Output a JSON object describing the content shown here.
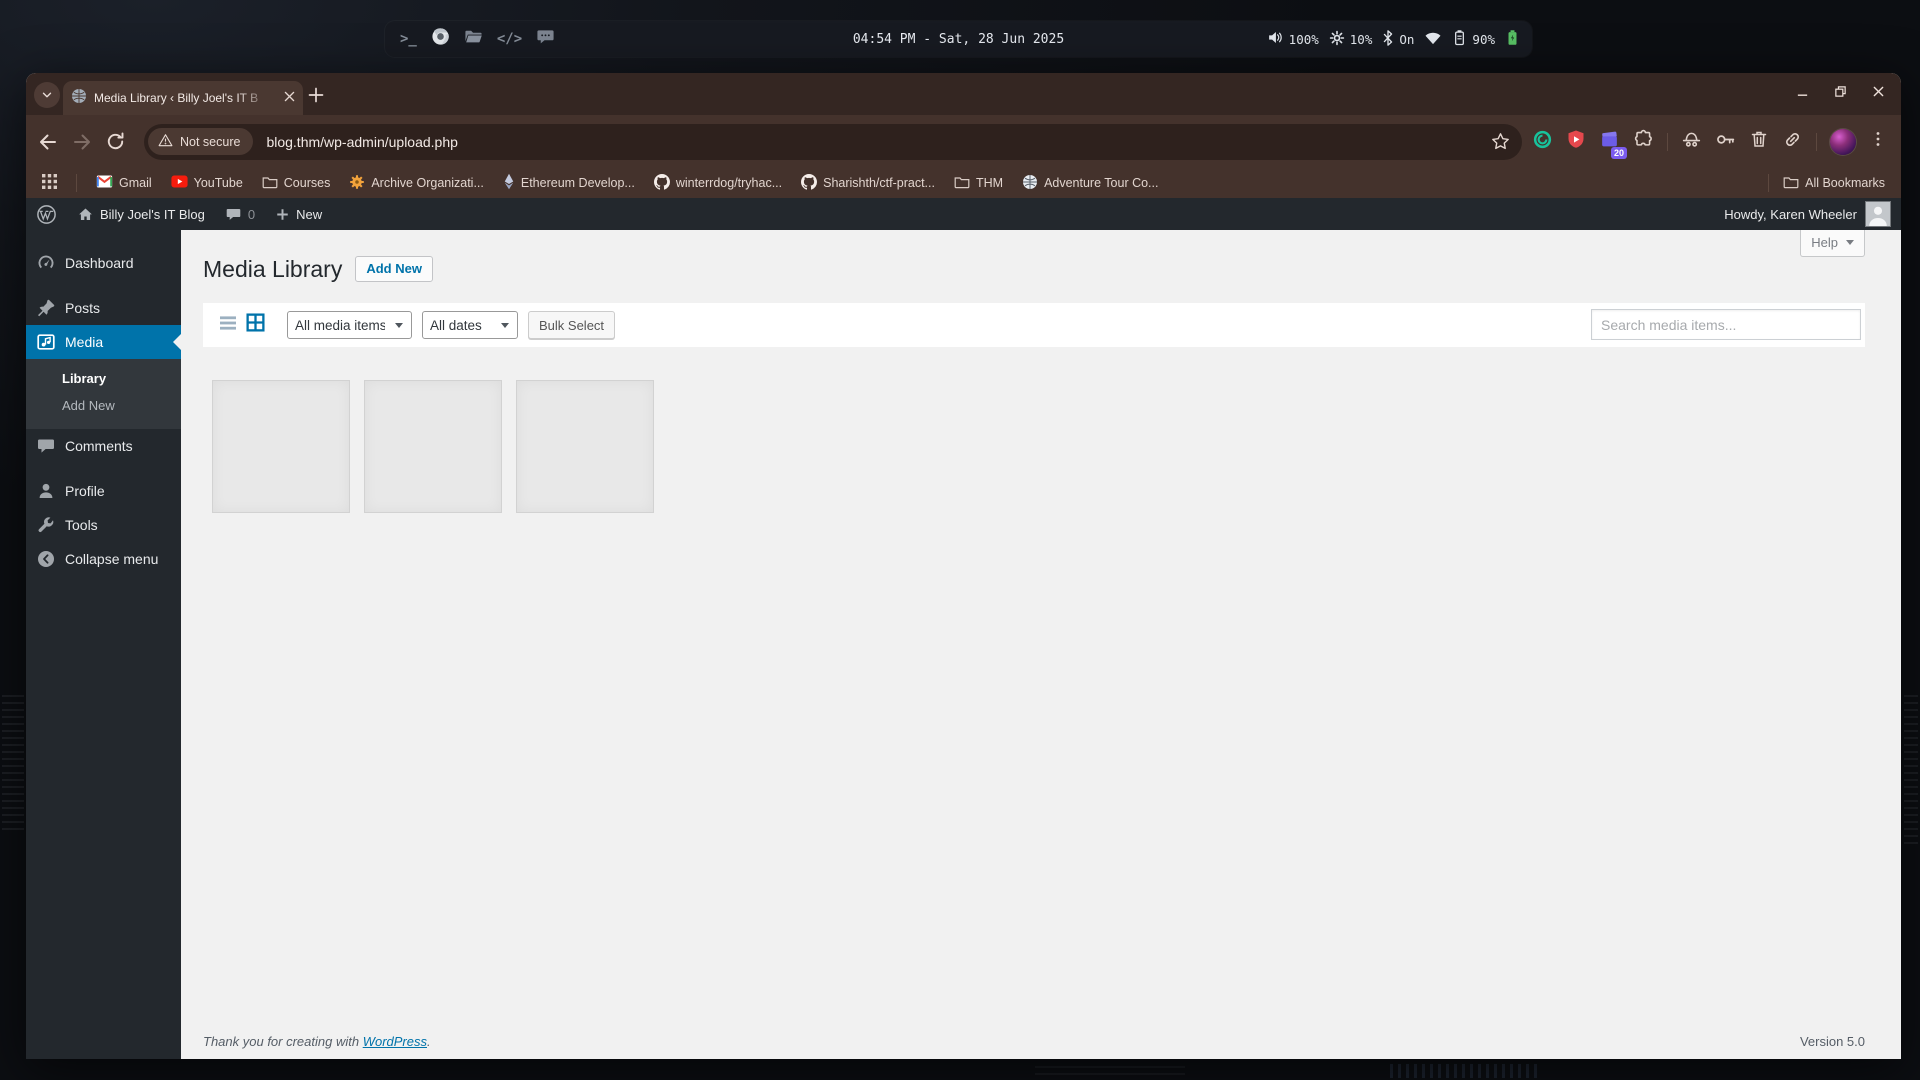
{
  "colors": {
    "accent_blue": "#0073aa",
    "admin_dark": "#23282d",
    "submenu_dark": "#32373c",
    "content_bg": "#f1f1f1",
    "browser_frame": "#342622",
    "browser_toolbar": "#44322c",
    "topbar_bg": "#171a21",
    "battery_charge_green": "#58c064",
    "shield_red": "#e5484d",
    "wallet_purple": "#6c5ce7"
  },
  "desktop": {
    "topbar": {
      "clock": "04:54 PM - Sat, 28 Jun 2025",
      "dock_icons": [
        "terminal-icon",
        "chrome-icon",
        "file-manager-icon",
        "code-editor-icon",
        "chat-icon"
      ],
      "status": {
        "volume": "100%",
        "brightness": "10%",
        "bluetooth": "On",
        "battery": "90%"
      }
    }
  },
  "browser": {
    "tab_title": "Media Library ‹ Billy Joel's IT B",
    "address_bar": {
      "security_chip": "Not secure",
      "url": "blog.thm/wp-admin/upload.php",
      "extension_badge": "20"
    },
    "bookmarks_bar": {
      "items": [
        {
          "label": "Gmail",
          "icon": "gmail-icon"
        },
        {
          "label": "YouTube",
          "icon": "youtube-icon"
        },
        {
          "label": "Courses",
          "icon": "bookmark-folder-icon"
        },
        {
          "label": "Archive Organizati...",
          "icon": "archive-gear-icon"
        },
        {
          "label": "Ethereum Develop...",
          "icon": "ethereum-icon"
        },
        {
          "label": "winterrdog/tryhac...",
          "icon": "github-icon"
        },
        {
          "label": "Sharishth/ctf-pract...",
          "icon": "github-icon"
        },
        {
          "label": "THM",
          "icon": "bookmark-folder-icon"
        },
        {
          "label": "Adventure Tour Co...",
          "icon": "globe-icon"
        }
      ],
      "all_bookmarks": "All Bookmarks"
    }
  },
  "wordpress": {
    "admin_bar": {
      "site_name": "Billy Joel's IT Blog",
      "comment_count": "0",
      "new_label": "New",
      "greeting": "Howdy, Karen Wheeler"
    },
    "menu": {
      "items": [
        {
          "label": "Dashboard"
        },
        {
          "label": "Posts"
        },
        {
          "label": "Media",
          "active": true
        },
        {
          "label": "Comments"
        },
        {
          "label": "Profile"
        },
        {
          "label": "Tools"
        },
        {
          "label": "Collapse menu"
        }
      ],
      "media_submenu": [
        {
          "label": "Library",
          "current": true
        },
        {
          "label": "Add New"
        }
      ]
    },
    "page": {
      "title": "Media Library",
      "add_new_button": "Add New",
      "help_button": "Help",
      "filter_media_type": "All media items",
      "filter_date": "All dates",
      "bulk_select_button": "Bulk Select",
      "search_placeholder": "Search media items...",
      "media_item_count": 3
    },
    "footer": {
      "thanks_text": "Thank you for creating with",
      "wordpress_link": "WordPress",
      "period": ".",
      "version": "Version 5.0"
    }
  }
}
